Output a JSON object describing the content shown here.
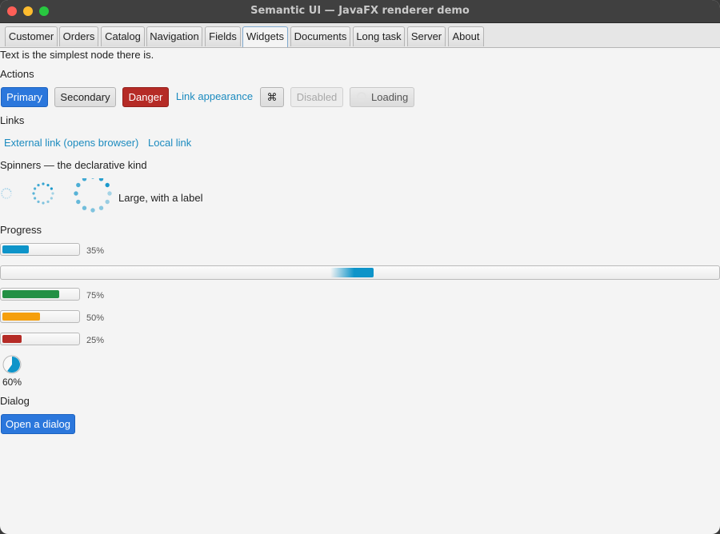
{
  "window": {
    "title": "Semantic UI — JavaFX renderer demo"
  },
  "tabs": [
    "Customer",
    "Orders",
    "Catalog",
    "Navigation",
    "Fields",
    "Widgets",
    "Documents",
    "Long task",
    "Server",
    "About"
  ],
  "active_tab": "Widgets",
  "intro_text": "Text is the simplest node there is.",
  "sections": {
    "actions": "Actions",
    "links": "Links",
    "spinners": "Spinners — the declarative kind",
    "progress": "Progress",
    "dialog": "Dialog"
  },
  "buttons": {
    "primary": "Primary",
    "secondary": "Secondary",
    "danger": "Danger",
    "link": "Link appearance",
    "icon": "⌘",
    "disabled": "Disabled",
    "loading": "Loading"
  },
  "links": {
    "external": "External link (opens browser)",
    "local": "Local link"
  },
  "spinner_label": "Large, with a label",
  "progress": {
    "bar1": {
      "value": 0.35,
      "label": "35%",
      "color": "#0e94c9"
    },
    "indeterminate": {
      "color": "#0e94c9"
    },
    "bar2": {
      "value": 0.75,
      "label": "75%",
      "color": "#239044"
    },
    "bar3": {
      "value": 0.5,
      "label": "50%",
      "color": "#f59f0c"
    },
    "bar4": {
      "value": 0.25,
      "label": "25%",
      "color": "#b52b26"
    },
    "circle": {
      "value": 0.6,
      "label": "60%",
      "color": "#0e94c9"
    }
  },
  "dialog_button": "Open a dialog",
  "colors": {
    "primary": "#2b77dc",
    "danger": "#b52b26",
    "link": "#1c8bbf",
    "accent": "#0e94c9"
  }
}
